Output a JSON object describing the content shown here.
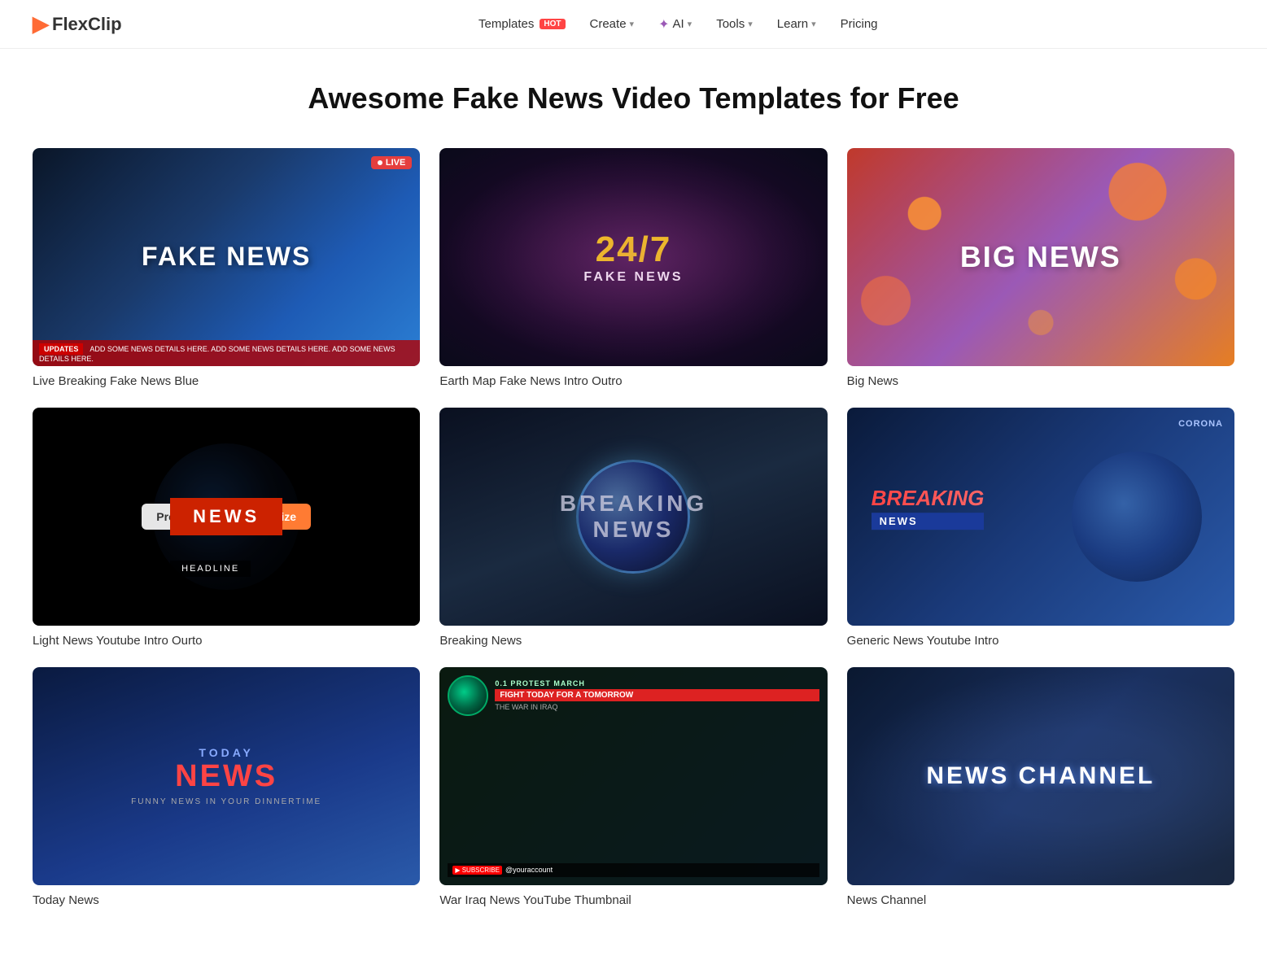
{
  "brand": {
    "name": "FlexClip",
    "logo_symbol": "▶"
  },
  "nav": {
    "links": [
      {
        "id": "templates",
        "label": "Templates",
        "hot": true,
        "dropdown": false
      },
      {
        "id": "create",
        "label": "Create",
        "dropdown": true
      },
      {
        "id": "ai",
        "label": "AI",
        "dropdown": true,
        "ai": true
      },
      {
        "id": "tools",
        "label": "Tools",
        "dropdown": true
      },
      {
        "id": "learn",
        "label": "Learn",
        "dropdown": true
      },
      {
        "id": "pricing",
        "label": "Pricing",
        "dropdown": false
      }
    ]
  },
  "page": {
    "title": "Awesome Fake News Video Templates for Free"
  },
  "templates": [
    {
      "id": "live-breaking-fake-news-blue",
      "name": "Live Breaking Fake News Blue",
      "live": true,
      "thumb_type": "1"
    },
    {
      "id": "earth-map-fake-news-intro-outro",
      "name": "Earth Map Fake News Intro Outro",
      "live": false,
      "thumb_type": "2"
    },
    {
      "id": "big-news",
      "name": "Big News",
      "live": false,
      "thumb_type": "3"
    },
    {
      "id": "light-news-youtube-intro-ourto",
      "name": "Light News Youtube Intro Ourto",
      "live": false,
      "thumb_type": "4",
      "hovered": true
    },
    {
      "id": "breaking-news",
      "name": "Breaking News",
      "live": false,
      "thumb_type": "5"
    },
    {
      "id": "generic-news-youtube-intro",
      "name": "Generic News Youtube Intro",
      "live": false,
      "thumb_type": "6"
    },
    {
      "id": "today-news",
      "name": "Today News",
      "live": false,
      "thumb_type": "7"
    },
    {
      "id": "war-iraq-news-thumbnail",
      "name": "War Iraq News YouTube Thumbnail",
      "live": false,
      "thumb_type": "8"
    },
    {
      "id": "news-channel",
      "name": "News Channel",
      "live": false,
      "thumb_type": "9"
    }
  ],
  "buttons": {
    "preview": "Preview",
    "customize": "Customize",
    "live_label": "LIVE"
  }
}
